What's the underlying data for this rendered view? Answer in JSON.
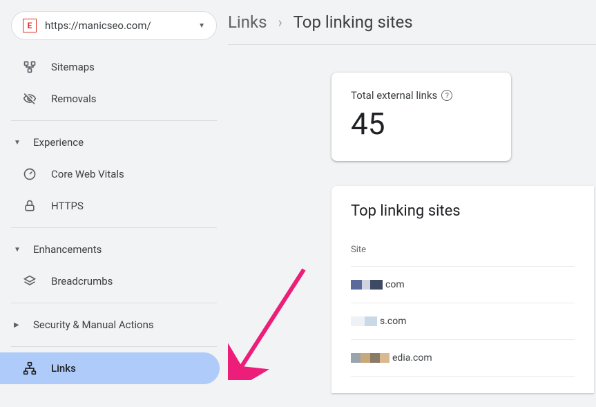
{
  "property": {
    "favicon_letter": "E",
    "url": "https://manicseo.com/"
  },
  "sidebar": {
    "items_top": [
      {
        "label": "Sitemaps"
      },
      {
        "label": "Removals"
      }
    ],
    "sections": [
      {
        "label": "Experience",
        "items": [
          {
            "label": "Core Web Vitals"
          },
          {
            "label": "HTTPS"
          }
        ]
      },
      {
        "label": "Enhancements",
        "items": [
          {
            "label": "Breadcrumbs"
          }
        ]
      },
      {
        "label": "Security & Manual Actions",
        "items": []
      }
    ],
    "links_label": "Links"
  },
  "breadcrumb": {
    "parent": "Links",
    "current": "Top linking sites"
  },
  "stat": {
    "label": "Total external links",
    "value": "45"
  },
  "sites_card": {
    "title": "Top linking sites",
    "col_header": "Site",
    "rows": [
      {
        "suffix": "com"
      },
      {
        "suffix": "s.com"
      },
      {
        "suffix": "edia.com"
      }
    ]
  }
}
